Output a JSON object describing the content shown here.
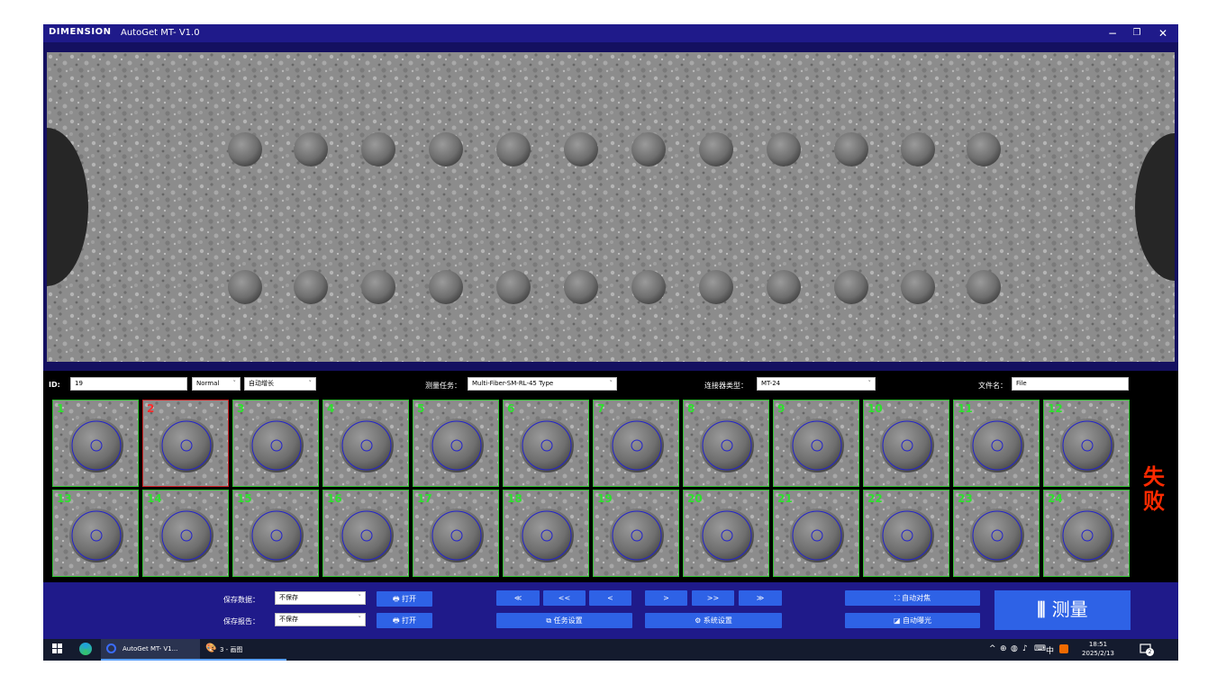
{
  "window": {
    "logo": "DIMENSION",
    "title": "AutoGet  MT- V1.0",
    "controls": [
      "−",
      "❐",
      "✕"
    ]
  },
  "form": {
    "id_label": "ID:",
    "id_value": "19",
    "mode_value": "Normal",
    "increment_value": "自动增长",
    "task_label": "测量任务：",
    "task_value": "Multi-Fiber-SM-RL-45 Type",
    "connector_label": "连接器类型：",
    "connector_value": "MT-24",
    "filename_label": "文件名：",
    "filename_value": "File"
  },
  "fibers": [
    {
      "num": "1",
      "fail": false
    },
    {
      "num": "2",
      "fail": true
    },
    {
      "num": "3",
      "fail": false
    },
    {
      "num": "4",
      "fail": false
    },
    {
      "num": "5",
      "fail": false
    },
    {
      "num": "6",
      "fail": false
    },
    {
      "num": "7",
      "fail": false
    },
    {
      "num": "8",
      "fail": false
    },
    {
      "num": "9",
      "fail": false
    },
    {
      "num": "10",
      "fail": false
    },
    {
      "num": "11",
      "fail": false
    },
    {
      "num": "12",
      "fail": false
    },
    {
      "num": "13",
      "fail": false
    },
    {
      "num": "14",
      "fail": false
    },
    {
      "num": "15",
      "fail": false
    },
    {
      "num": "16",
      "fail": false
    },
    {
      "num": "17",
      "fail": false
    },
    {
      "num": "18",
      "fail": false
    },
    {
      "num": "19",
      "fail": false
    },
    {
      "num": "20",
      "fail": false
    },
    {
      "num": "21",
      "fail": false
    },
    {
      "num": "22",
      "fail": false
    },
    {
      "num": "23",
      "fail": false
    },
    {
      "num": "24",
      "fail": false
    }
  ],
  "result": "失败",
  "bottom": {
    "save_data_label": "保存数据：",
    "save_data_value": "不保存",
    "save_report_label": "保存报告：",
    "save_report_value": "不保存",
    "open_label": "打开",
    "nav": [
      "≪",
      "<<",
      "<",
      ">",
      ">>",
      "≫"
    ],
    "task_settings": "任务设置",
    "system_settings": "系统设置",
    "auto_focus": "自动对焦",
    "auto_exposure": "自动曝光",
    "measure": "测量"
  },
  "taskbar": {
    "app1": "AutoGet MT- V1...",
    "app2": "3 - 画图",
    "ime": "中",
    "time": "18:51",
    "date": "2025/2/13",
    "notif_count": "2"
  },
  "colors": {
    "frame": "#1f1a8a",
    "pass": "#2fc42f",
    "fail": "#ff2a2a",
    "button": "#2e62e6"
  }
}
